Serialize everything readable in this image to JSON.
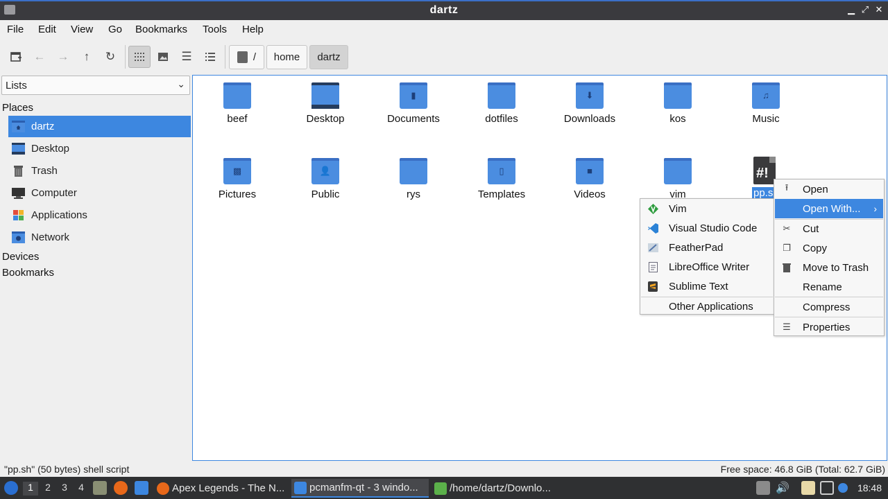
{
  "window": {
    "title": "dartz"
  },
  "menubar": [
    "File",
    "Edit",
    "View",
    "Go",
    "Bookmarks",
    "Tools",
    "Help"
  ],
  "breadcrumb": {
    "root": "/",
    "items": [
      "home",
      "dartz"
    ]
  },
  "sidebar": {
    "dropdown_value": "Lists",
    "places_heading": "Places",
    "places": [
      "dartz",
      "Desktop",
      "Trash",
      "Computer",
      "Applications",
      "Network"
    ],
    "devices_heading": "Devices",
    "bookmarks_heading": "Bookmarks"
  },
  "files": {
    "row1": [
      "beef",
      "Desktop",
      "Documents",
      "dotfiles",
      "Downloads",
      "kos",
      "Music"
    ],
    "row2": [
      "Pictures",
      "Public",
      "rys",
      "Templates",
      "Videos",
      "vim"
    ],
    "selected": "pp.sh",
    "selected_visible": "pp.s"
  },
  "context_menu": {
    "items": [
      "Open",
      "Open With...",
      "Cut",
      "Copy",
      "Move to Trash",
      "Rename",
      "Compress",
      "Properties"
    ],
    "highlighted": "Open With..."
  },
  "open_with_menu": {
    "apps": [
      "Vim",
      "Visual Studio Code",
      "FeatherPad",
      "LibreOffice Writer",
      "Sublime Text"
    ],
    "other": "Other Applications"
  },
  "status": {
    "left": "\"pp.sh\" (50 bytes) shell script",
    "right": "Free space: 46.8 GiB (Total: 62.7 GiB)"
  },
  "taskbar": {
    "workspaces": [
      "1",
      "2",
      "3",
      "4"
    ],
    "active_workspace": "1",
    "tasks": [
      "Apex Legends - The N...",
      "pcmanfm-qt - 3 windo...",
      "/home/dartz/Downlo..."
    ],
    "clock": "18:48"
  },
  "colors": {
    "accent": "#3d87e0",
    "folder": "#4b8de0",
    "taskbar": "#2f3032"
  }
}
